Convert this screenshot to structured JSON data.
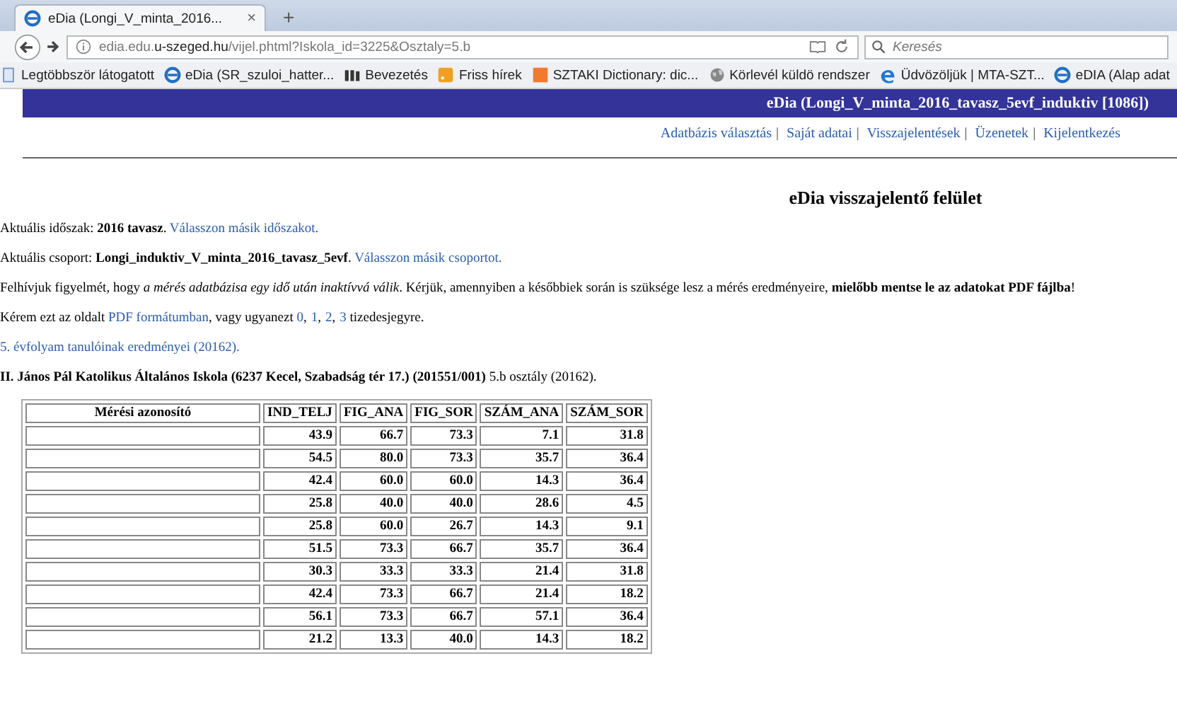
{
  "browser": {
    "tabs": [
      {
        "title": "eDia (Longi_V_minta_2016...",
        "close": "×",
        "selected": true
      }
    ],
    "new_tab": "+",
    "url": {
      "prefix": "edia.edu.",
      "domain": "u-szeged.hu",
      "path": "/vijel.phtml?Iskola_id=3225&Osztaly=5.b"
    },
    "search_placeholder": "Keresés",
    "bookmarks": [
      {
        "label": "Legtöbbször látogatott",
        "kind": "page"
      },
      {
        "label": "eDia (SR_szuloi_hatter...",
        "kind": "edia"
      },
      {
        "label": "Bevezetés",
        "kind": "m"
      },
      {
        "label": "Friss hírek",
        "kind": "rss"
      },
      {
        "label": "SZTAKI Dictionary: dic...",
        "kind": "sz"
      },
      {
        "label": "Körlevél küldö rendszer",
        "kind": "globe"
      },
      {
        "label": "Üdvözöljük | MTA-SZT...",
        "kind": "edge"
      },
      {
        "label": "eDIA (Alap adat",
        "kind": "edia"
      }
    ]
  },
  "page": {
    "header": "eDia (Longi_V_minta_2016_tavasz_5evf_induktiv [1086])",
    "nav_links": [
      {
        "label": "Adatbázis választás"
      },
      {
        "separator": "|",
        "label": "Saját adatai"
      },
      {
        "separator": "|",
        "label": "Visszajelentések"
      },
      {
        "separator": "|",
        "label": "Üzenetek"
      },
      {
        "separator": "|",
        "label": "Kijelentkezés"
      }
    ],
    "title": "eDia visszajelentő felület",
    "period": {
      "label": "Aktuális időszak: ",
      "value": "2016 tavasz",
      "end": ".",
      "link": "Válasszon másik időszakot."
    },
    "group": {
      "label": "Aktuális csoport: ",
      "value": "Longi_induktiv_V_minta_2016_tavasz_5evf",
      "end": ".",
      "link": "Válasszon másik csoportot."
    },
    "notice": "Felhívjuk figyelmét, hogy *a mérés adatbázisa egy idő után inaktívvá válik*. Kérjük, amennyiben a későbbiek során is szüksége lesz a mérés eredményeire, **mielőbb mentse le az adatokat PDF fájlba**!",
    "pdf_line": {
      "before": "Kérem ezt az oldalt ",
      "pdf_link": "PDF formátumban",
      "middle": ", vagy ugyanezt ",
      "digit_links": [
        {
          "label": "0"
        },
        {
          "separator": ",",
          "label": "1"
        },
        {
          "separator": ",",
          "label": "2"
        },
        {
          "separator": ",",
          "label": "3"
        }
      ],
      "after": " tizedesjegyre."
    },
    "grade_link": "5. évfolyam tanulóinak eredményei (20162).",
    "school": "**II. János Pál Katolikus Általános Iskola (6237 Kecel, Szabadság tér 17.) (201551/001)** 5.b osztály (20162).",
    "table": {
      "columns": [
        "Mérési azonosító",
        "IND_TELJ",
        "FIG_ANA",
        "FIG_SOR",
        "SZÁM_ANA",
        "SZÁM_SOR"
      ],
      "rows": [
        [
          "",
          "43.9",
          "66.7",
          "73.3",
          "7.1",
          "31.8"
        ],
        [
          "",
          "54.5",
          "80.0",
          "73.3",
          "35.7",
          "36.4"
        ],
        [
          "",
          "42.4",
          "60.0",
          "60.0",
          "14.3",
          "36.4"
        ],
        [
          "",
          "25.8",
          "40.0",
          "40.0",
          "28.6",
          "4.5"
        ],
        [
          "",
          "25.8",
          "60.0",
          "26.7",
          "14.3",
          "9.1"
        ],
        [
          "",
          "51.5",
          "73.3",
          "66.7",
          "35.7",
          "36.4"
        ],
        [
          "",
          "30.3",
          "33.3",
          "33.3",
          "21.4",
          "31.8"
        ],
        [
          "",
          "42.4",
          "73.3",
          "66.7",
          "21.4",
          "18.2"
        ],
        [
          "",
          "56.1",
          "73.3",
          "66.7",
          "57.1",
          "36.4"
        ],
        [
          "",
          "21.2",
          "13.3",
          "40.0",
          "14.3",
          "18.2"
        ]
      ]
    }
  }
}
